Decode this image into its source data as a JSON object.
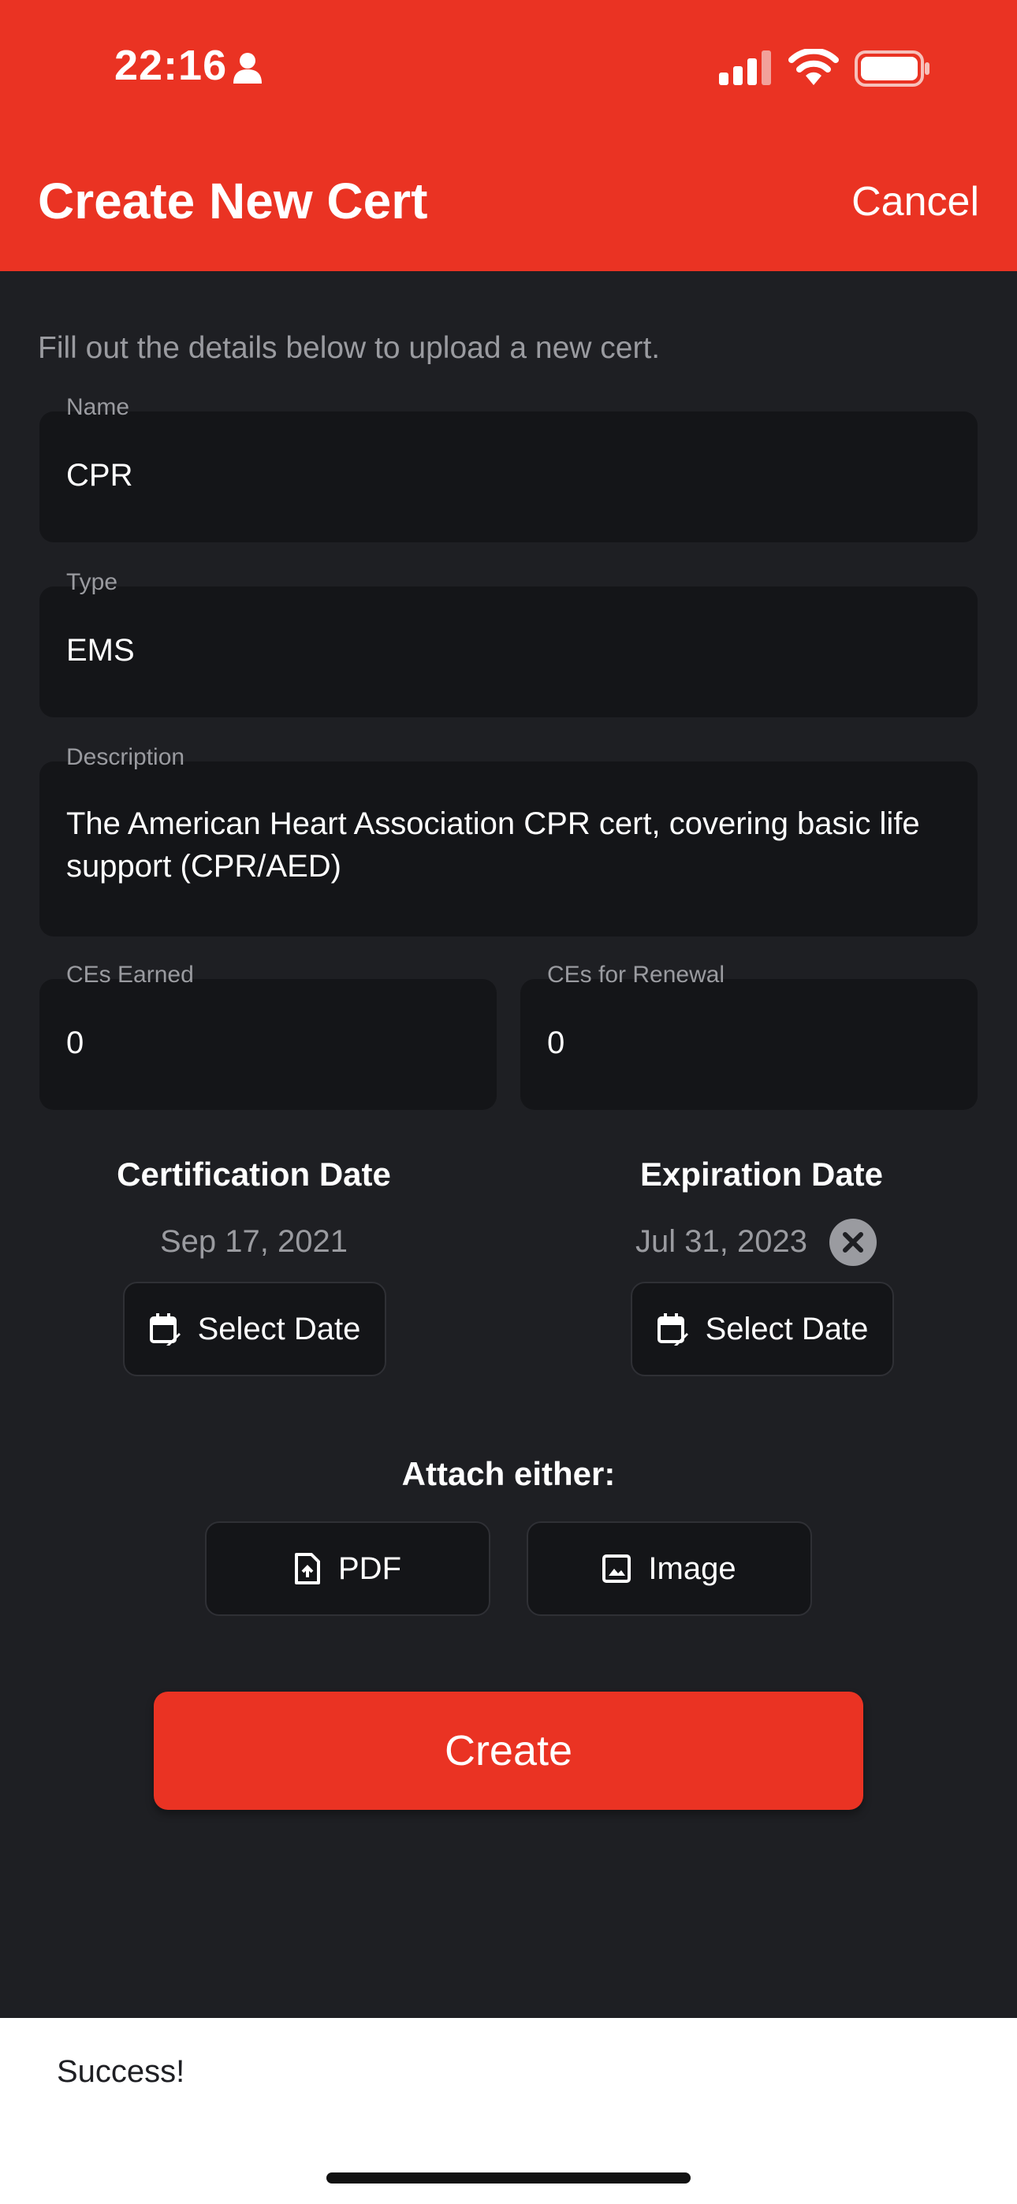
{
  "status_bar": {
    "time": "22:16"
  },
  "header": {
    "title": "Create New Cert",
    "cancel_label": "Cancel"
  },
  "subtitle": "Fill out the details below to upload a new cert.",
  "fields": {
    "name": {
      "label": "Name",
      "value": "CPR"
    },
    "type": {
      "label": "Type",
      "value": "EMS"
    },
    "description": {
      "label": "Description",
      "value": "The American Heart Association CPR cert, covering basic life support (CPR/AED)"
    },
    "ces_earned": {
      "label": "CEs Earned",
      "value": "0"
    },
    "ces_renewal": {
      "label": "CEs for Renewal",
      "value": "0"
    }
  },
  "dates": {
    "certification": {
      "title": "Certification Date",
      "value": "Sep 17, 2021",
      "button_label": "Select Date"
    },
    "expiration": {
      "title": "Expiration Date",
      "value": "Jul 31, 2023",
      "button_label": "Select Date"
    }
  },
  "attach": {
    "title": "Attach either:",
    "pdf_label": "PDF",
    "image_label": "Image"
  },
  "create_label": "Create",
  "snackbar": {
    "message": "Success!"
  },
  "colors": {
    "accent": "#ea3323",
    "background": "#1e1f23",
    "field": "#141518",
    "muted": "#9a9ba0"
  }
}
